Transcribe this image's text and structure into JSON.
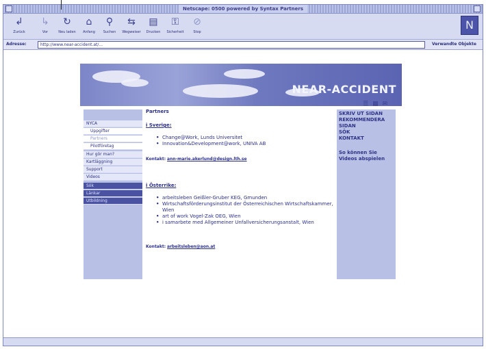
{
  "window": {
    "title": "Netscape: 0500 powered by Syntax Partners"
  },
  "toolbar": {
    "buttons": [
      {
        "label": "Zurück",
        "icon": "back-arrow-icon"
      },
      {
        "label": "Vor",
        "icon": "forward-arrow-icon"
      },
      {
        "label": "Neu laden",
        "icon": "reload-icon"
      },
      {
        "label": "Anfang",
        "icon": "home-icon"
      },
      {
        "label": "Suchen",
        "icon": "search-icon"
      },
      {
        "label": "Wegweiser",
        "icon": "guide-icon"
      },
      {
        "label": "Drucken",
        "icon": "print-icon"
      },
      {
        "label": "Sicherheit",
        "icon": "security-icon"
      },
      {
        "label": "Stop",
        "icon": "stop-icon"
      }
    ]
  },
  "address": {
    "label": "Adresse:",
    "url": "http://www.near-accident.at/...",
    "related": "Verwandte Objekte"
  },
  "banner": {
    "logo": "NEAR-ACCIDENT"
  },
  "left_nav": [
    {
      "label": "NYCA",
      "style": "light"
    },
    {
      "label": "Uppgifter",
      "style": "white"
    },
    {
      "label": "Partners",
      "style": "white"
    },
    {
      "label": "Pilotföretag",
      "style": "white"
    },
    {
      "label": "Hur gör man?",
      "style": "light"
    },
    {
      "label": "Kartläggning",
      "style": "light"
    },
    {
      "label": "Support",
      "style": "light"
    },
    {
      "label": "Videos",
      "style": "light"
    },
    {
      "label": "Sök",
      "style": "dark"
    },
    {
      "label": "Länkar",
      "style": "dark"
    },
    {
      "label": "Utbildning",
      "style": "dark"
    }
  ],
  "main": {
    "heading": "Partners",
    "sweden": {
      "title": "i Sverige:",
      "items": [
        "Change@Work, Lunds Universitet",
        "Innovation&Development@work, UNIVA AB"
      ],
      "contact_label": "Kontakt:",
      "contact_email": "ann-marie.akerlund@design.lth.se"
    },
    "austria": {
      "title": "i Österrike:",
      "items": [
        "arbeitsleben Geißler-Gruber KEG, Gmunden",
        "Wirtschaftsförderungsinstitut der Österreichischen Wirtschaftskammer, Wien",
        "art of work Vogel-Zak OEG, Wien",
        "i samarbete med Allgemeiner Unfallversicherungsanstalt, Wien"
      ],
      "contact_label": "Kontakt:",
      "contact_email": "arbeitsleben@aon.at"
    }
  },
  "right_nav": [
    "SKRIV UT SIDAN",
    "REKOMMENDERA SIDAN",
    "SÖK",
    "KONTAKT",
    "So können Sie Videos abspielen"
  ]
}
